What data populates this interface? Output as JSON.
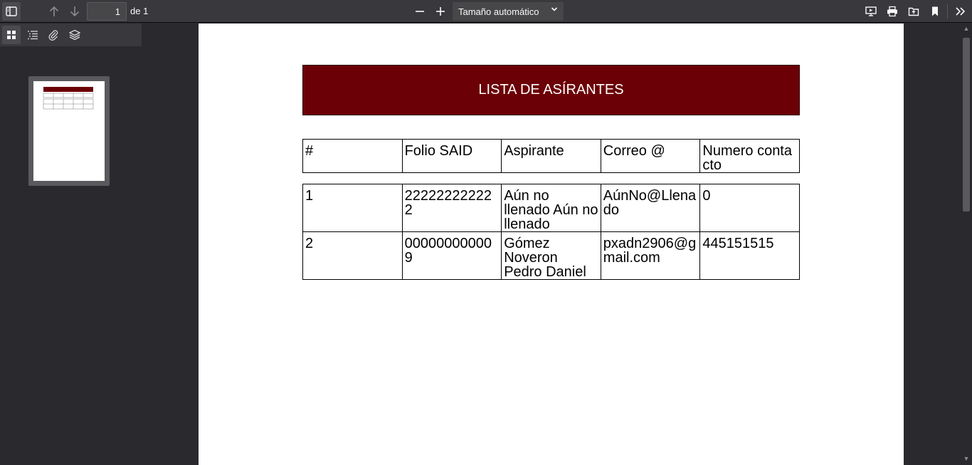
{
  "toolbar": {
    "page_number": "1",
    "page_of": "de 1",
    "zoom_value": "Tamaño automático"
  },
  "icons": {
    "sidebar_toggle": "sidebar-toggle-icon",
    "prev": "arrow-up-icon",
    "next": "arrow-down-icon",
    "zoom_out": "minus-icon",
    "zoom_in": "plus-icon",
    "presentation": "presentation-icon",
    "print": "print-icon",
    "open": "open-file-icon",
    "bookmark": "bookmark-icon",
    "more": "double-chevron-right-icon"
  },
  "document": {
    "title": "LISTA DE ASÍRANTES",
    "header": [
      "#",
      "Folio SAID",
      "Aspirante",
      "Correo @",
      "Numero contacto"
    ],
    "rows": [
      [
        "1",
        "222222222222",
        "Aún no llenado Aún no llenado",
        "AúnNo@Llenado",
        "0"
      ],
      [
        "2",
        "000000000009",
        "Gómez Noveron Pedro Daniel",
        "pxadn2906@gmail.com",
        "445151515"
      ]
    ]
  },
  "colors": {
    "title_bg": "#6b0006",
    "toolbar_bg": "#38383d",
    "viewer_bg": "#2a2a2e"
  }
}
